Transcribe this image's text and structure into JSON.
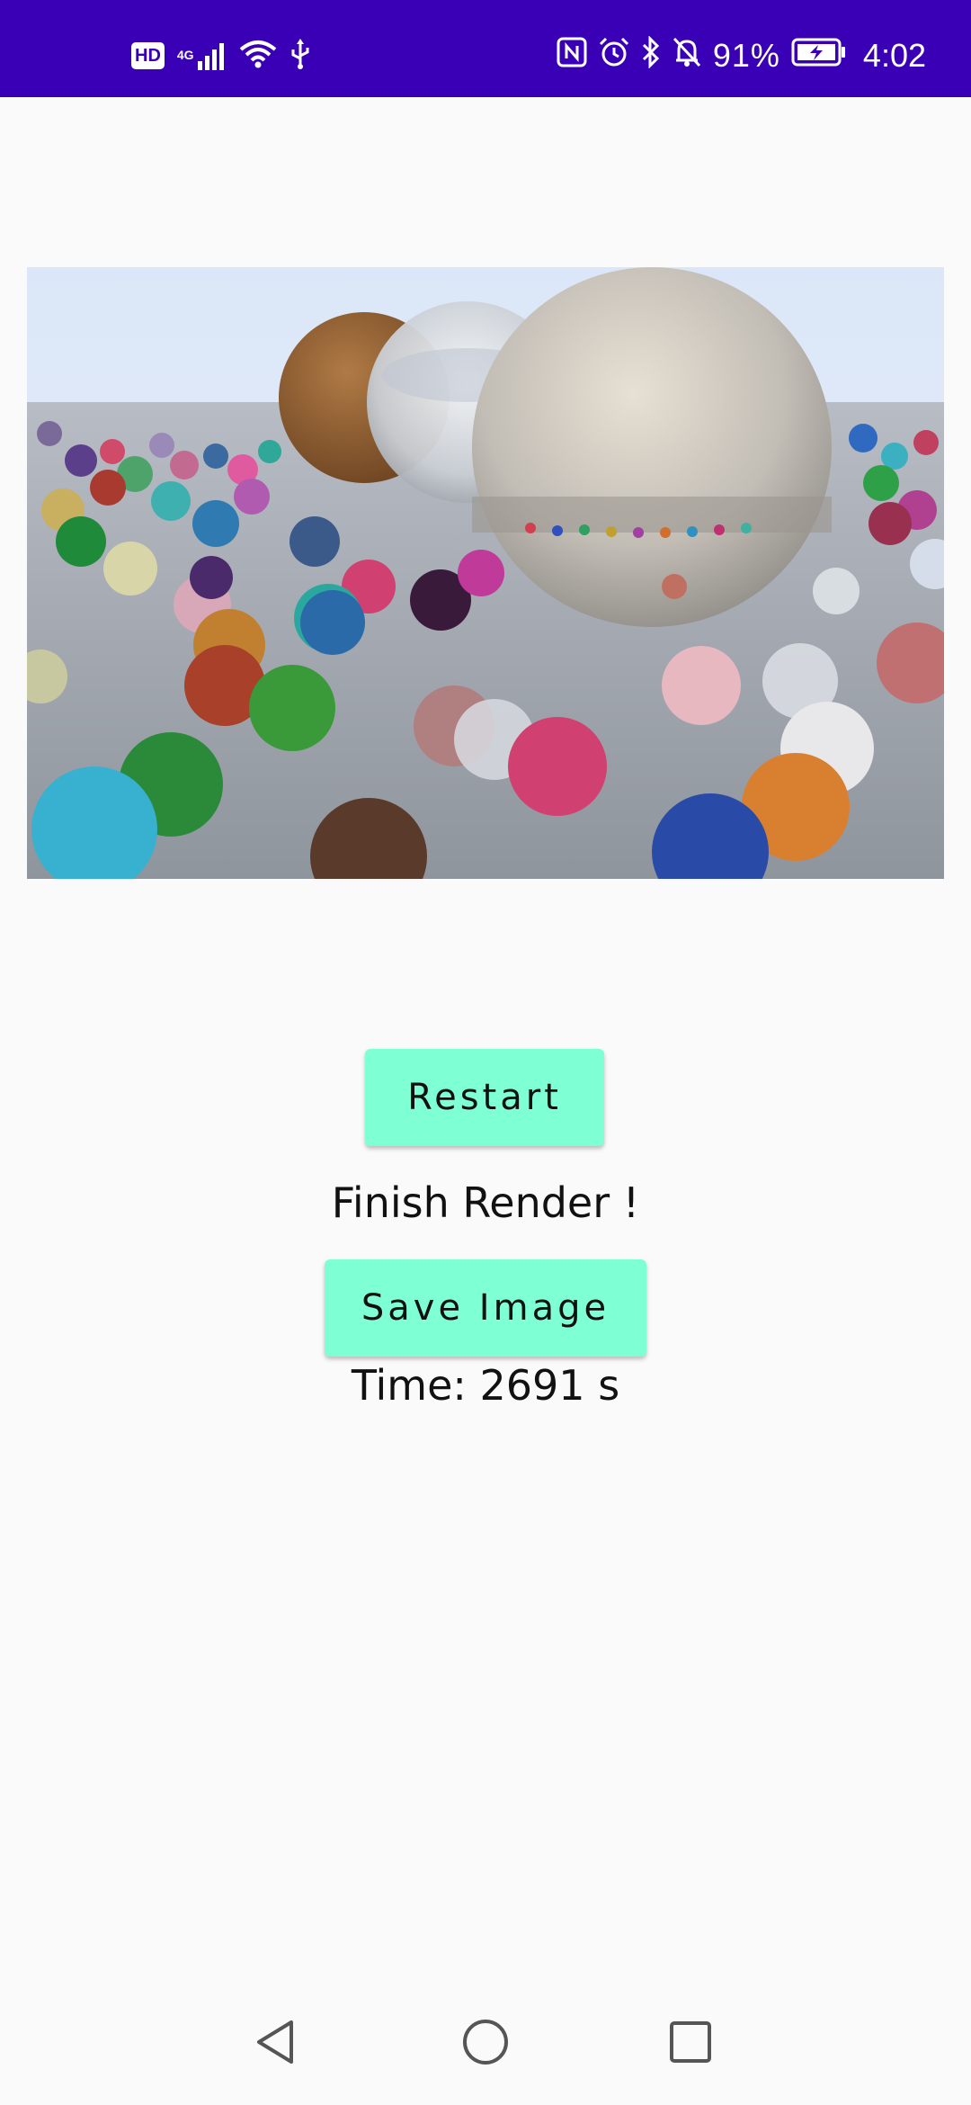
{
  "status_bar": {
    "hd_badge": "HD",
    "network": "4G",
    "icons": [
      "hd-icon",
      "signal-icon",
      "wifi-icon",
      "usb-icon",
      "nfc-icon",
      "alarm-icon",
      "bluetooth-icon",
      "bell-muted-icon",
      "battery-charging-icon"
    ],
    "battery_percent": "91%",
    "time": "4:02",
    "background": "#3a00b5"
  },
  "render": {
    "description_icon": "ray-traced-spheres-image",
    "sky_color": "#dde8f7",
    "ground_color": "#9aa0a8"
  },
  "controls": {
    "restart_label": "Restart",
    "status_message": "Finish Render !",
    "save_label": "Save Image",
    "time_text": "Time: 2691 s",
    "button_color": "#7fffd4"
  },
  "nav_bar": {
    "icons": [
      "back-icon",
      "home-icon",
      "recents-icon"
    ]
  }
}
